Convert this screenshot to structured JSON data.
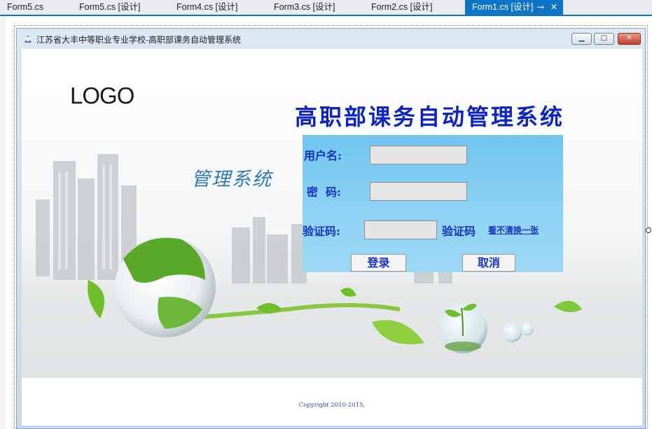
{
  "tabs": [
    {
      "label": "Form5.cs"
    },
    {
      "label": "Form5.cs [设计]"
    },
    {
      "label": "Form4.cs [设计]"
    },
    {
      "label": "Form3.cs [设计]"
    },
    {
      "label": "Form2.cs [设计]"
    },
    {
      "label": "Form1.cs [设计]",
      "active": true
    }
  ],
  "tab_icons": {
    "pin": "pin-icon",
    "close": "close-icon"
  },
  "window": {
    "title": "江苏省大丰中等职业专业学校-高职部课务自动管理系统",
    "controls": [
      "minimize-icon",
      "maximize-icon",
      "close-icon"
    ]
  },
  "banner": {
    "logo_text": "LOGO",
    "subtitle_art": "管理系统",
    "system_title": "高职部课务自动管理系统"
  },
  "login": {
    "username_label": "用户名:",
    "password_label": "密  码:",
    "captcha_label": "验证码:",
    "username_value": "",
    "password_value": "",
    "captcha_value": "",
    "captcha_image_text": "验证码",
    "refresh_link": "看不清换一张",
    "login_button": "登录",
    "cancel_button": "取消"
  },
  "footer": {
    "copyright": "Copyright 2010-2015,"
  },
  "colors": {
    "accent_tab": "#0e74c6",
    "label_blue": "#1433c2",
    "panel_top": "#6fc6ee",
    "panel_bottom": "#9bd8f4"
  }
}
